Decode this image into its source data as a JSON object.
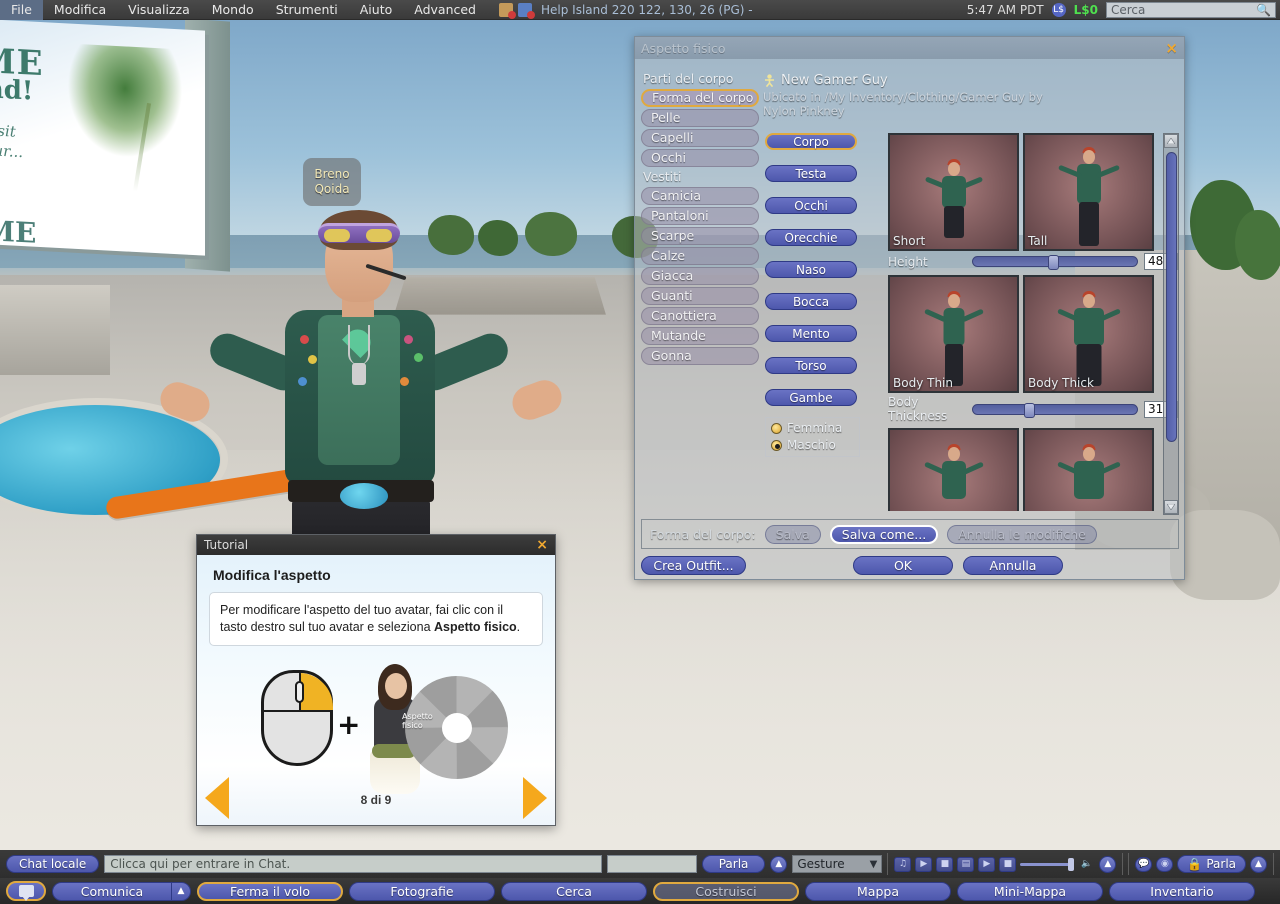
{
  "menubar": {
    "items": [
      "File",
      "Modifica",
      "Visualizza",
      "Mondo",
      "Strumenti",
      "Aiuto",
      "Advanced"
    ],
    "location": "Help Island 220 122, 130, 26 (PG) -",
    "clock": "5:47 AM PDT",
    "balance": "L$0",
    "search_placeholder": "Cerca",
    "icons": [
      "package-icon",
      "teleport-icon",
      "lindex-icon",
      "search-icon"
    ]
  },
  "world": {
    "avatar_name_line1": "Breno",
    "avatar_name_line2": "Qoida",
    "billboard": {
      "line1": "ME",
      "line2": "and!",
      "line3": "visit",
      "line4": "your...",
      "line5": "ME"
    }
  },
  "appearance": {
    "title": "Aspetto fisico",
    "close_label": "×",
    "body_parts_label": "Parti del corpo",
    "body_parts": [
      {
        "label": "Forma del corpo",
        "selected": true
      },
      {
        "label": "Pelle",
        "selected": false
      },
      {
        "label": "Capelli",
        "selected": false
      },
      {
        "label": "Occhi",
        "selected": false
      }
    ],
    "clothes_label": "Vestiti",
    "clothes": [
      {
        "label": "Camicia",
        "selected": false
      },
      {
        "label": "Pantaloni",
        "selected": false
      },
      {
        "label": "Scarpe",
        "selected": false
      },
      {
        "label": "Calze",
        "selected": false
      },
      {
        "label": "Giacca",
        "selected": false
      },
      {
        "label": "Guanti",
        "selected": false
      },
      {
        "label": "Canottiera",
        "selected": false
      },
      {
        "label": "Mutande",
        "selected": false
      },
      {
        "label": "Gonna",
        "selected": false
      }
    ],
    "item_name": "New Gamer Guy",
    "item_path": "Ubicato in /My Inventory/Clothing/Gamer Guy by Nylon Pinkney",
    "part_tabs": [
      {
        "label": "Corpo",
        "selected": true
      },
      {
        "label": "Testa",
        "selected": false
      },
      {
        "label": "Occhi",
        "selected": false
      },
      {
        "label": "Orecchie",
        "selected": false
      },
      {
        "label": "Naso",
        "selected": false
      },
      {
        "label": "Bocca",
        "selected": false
      },
      {
        "label": "Mento",
        "selected": false
      },
      {
        "label": "Torso",
        "selected": false
      },
      {
        "label": "Gambe",
        "selected": false
      }
    ],
    "gender": {
      "female_label": "Femmina",
      "male_label": "Maschio",
      "selected": "Maschio"
    },
    "sliders": [
      {
        "name": "Height",
        "value": "48",
        "percent": 46,
        "left_thumb_label": "Short",
        "right_thumb_label": "Tall"
      },
      {
        "name": "Body Thickness",
        "value": "31",
        "percent": 31,
        "left_thumb_label": "Body Thin",
        "right_thumb_label": "Body Thick"
      }
    ],
    "save_row": {
      "label": "Forma del corpo:",
      "save": "Salva",
      "save_as": "Salva come...",
      "revert": "Annulla le modifiche"
    },
    "footer": {
      "create_outfit": "Crea Outfit...",
      "ok": "OK",
      "cancel": "Annulla"
    }
  },
  "tutorial": {
    "title": "Tutorial",
    "close_label": "×",
    "heading": "Modifica l'aspetto",
    "body_part1": "Per modificare l'aspetto del tuo avatar, fai clic con il tasto destro sul tuo avatar e seleziona ",
    "body_bold": "Aspetto fisico",
    "body_part2": ".",
    "plus": "+",
    "pie_label": "Aspetto fisico",
    "page": "8 di 9",
    "prev_icon": "arrow-left-icon",
    "next_icon": "arrow-right-icon"
  },
  "chatbar": {
    "local_chat_label": "Chat locale",
    "chat_placeholder": "Clicca qui per entrare in Chat.",
    "talk_label": "Parla",
    "gesture_label": "Gesture",
    "voice_talk_label": "Parla",
    "media_icons": [
      "music-note-icon",
      "play-icon",
      "stop-icon",
      "media-icon",
      "play-icon",
      "stop-icon",
      "speaker-icon",
      "chevron-up-icon"
    ],
    "voice_icons": [
      "voice-chat-icon",
      "voice-dot-icon",
      "lock-icon",
      "chevron-up-icon"
    ]
  },
  "toolbar": {
    "buttons": [
      {
        "label": "Comunica",
        "highlight": false,
        "has_caret": true
      },
      {
        "label": "Ferma il volo",
        "highlight": true,
        "has_caret": false
      },
      {
        "label": "Fotografie",
        "highlight": false,
        "has_caret": false
      },
      {
        "label": "Cerca",
        "highlight": false,
        "has_caret": false
      },
      {
        "label": "Costruisci",
        "highlight": true,
        "dim": true,
        "has_caret": false
      },
      {
        "label": "Mappa",
        "highlight": false,
        "has_caret": false
      },
      {
        "label": "Mini-Mappa",
        "highlight": false,
        "has_caret": false
      },
      {
        "label": "Inventario",
        "highlight": false,
        "has_caret": false
      }
    ],
    "chat_icon": "chat-bubble-icon"
  }
}
